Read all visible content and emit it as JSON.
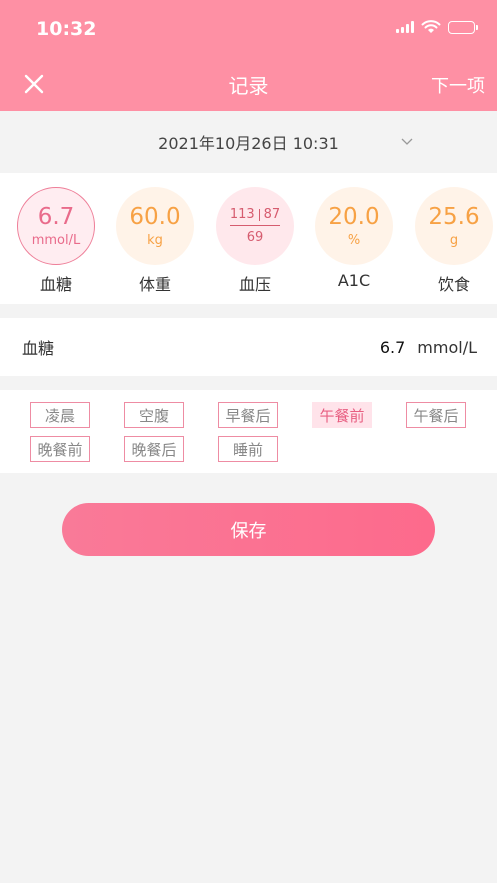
{
  "status_bar": {
    "time": "10:32"
  },
  "nav": {
    "title": "记录",
    "next_label": "下一项"
  },
  "date_selector": {
    "value": "2021年10月26日 10:31"
  },
  "metrics": [
    {
      "value": "6.7",
      "unit": "mmol/L",
      "label": "血糖",
      "selected": true
    },
    {
      "value": "60.0",
      "unit": "kg",
      "label": "体重"
    },
    {
      "systolic": "113",
      "diastolic": "87",
      "pulse": "69",
      "label": "血压"
    },
    {
      "value": "20.0",
      "unit": "%",
      "label": "A1C"
    },
    {
      "value": "25.6",
      "unit": "g",
      "label": "饮食"
    }
  ],
  "reading": {
    "label": "血糖",
    "value": "6.7",
    "unit": "mmol/L"
  },
  "time_tags": [
    {
      "label": "凌晨"
    },
    {
      "label": "空腹"
    },
    {
      "label": "早餐后"
    },
    {
      "label": "午餐前",
      "selected": true
    },
    {
      "label": "午餐后"
    },
    {
      "label": "晚餐前"
    },
    {
      "label": "晚餐后"
    },
    {
      "label": "睡前"
    }
  ],
  "save_button": {
    "label": "保存"
  },
  "colors": {
    "header": "#fe90a4",
    "accent_pink": "#e96b8b",
    "accent_orange": "#f7a144",
    "save_button": "#fd6a8c"
  }
}
